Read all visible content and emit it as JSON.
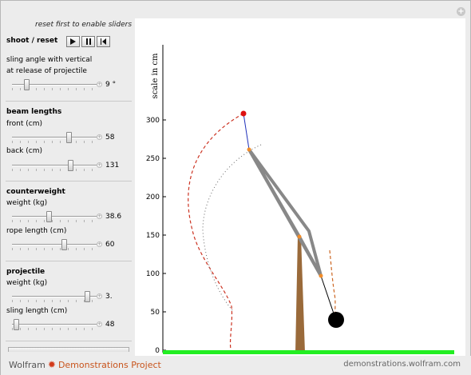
{
  "hint": "reset first to enable sliders",
  "shoot": {
    "label": "shoot / reset"
  },
  "sling_angle": {
    "label_line1": "sling angle with vertical",
    "label_line2": "at release of projectile",
    "value_text": "9 °",
    "fraction": 0.15
  },
  "beam": {
    "title": "beam lengths",
    "front_label": "front (cm)",
    "front_value": "58",
    "front_fraction": 0.69,
    "back_label": "back (cm)",
    "back_value": "131",
    "back_fraction": 0.71
  },
  "counterweight": {
    "title": "counterweight",
    "weight_label": "weight (kg)",
    "weight_value": "38.6",
    "weight_fraction": 0.43,
    "rope_label": "rope length (cm)",
    "rope_value": "60",
    "rope_fraction": 0.63
  },
  "projectile": {
    "title": "projectile",
    "weight_label": "weight (kg)",
    "weight_value": "3.",
    "weight_fraction": 0.92,
    "sling_label": "sling length (cm)",
    "sling_value": "48",
    "sling_fraction": 0.02
  },
  "plot": {
    "ylabel": "scale in cm",
    "yticks": [
      0,
      50,
      100,
      150,
      200,
      250,
      300
    ],
    "colors": {
      "beam": "#888888",
      "tower": "#9a6a3a",
      "ground": "#22ee22",
      "projectile": "#dd1111",
      "sling": "#2233bb",
      "pivot": "#f28c28",
      "projectile_path": "#cc3322",
      "sling_tip_path": "#666666",
      "counterweight": "#000000",
      "cw_path": "#cc6622"
    }
  },
  "footer": {
    "brand_left": "Wolfram",
    "brand_right": "Demonstrations Project",
    "site": "demonstrations.wolfram.com"
  }
}
